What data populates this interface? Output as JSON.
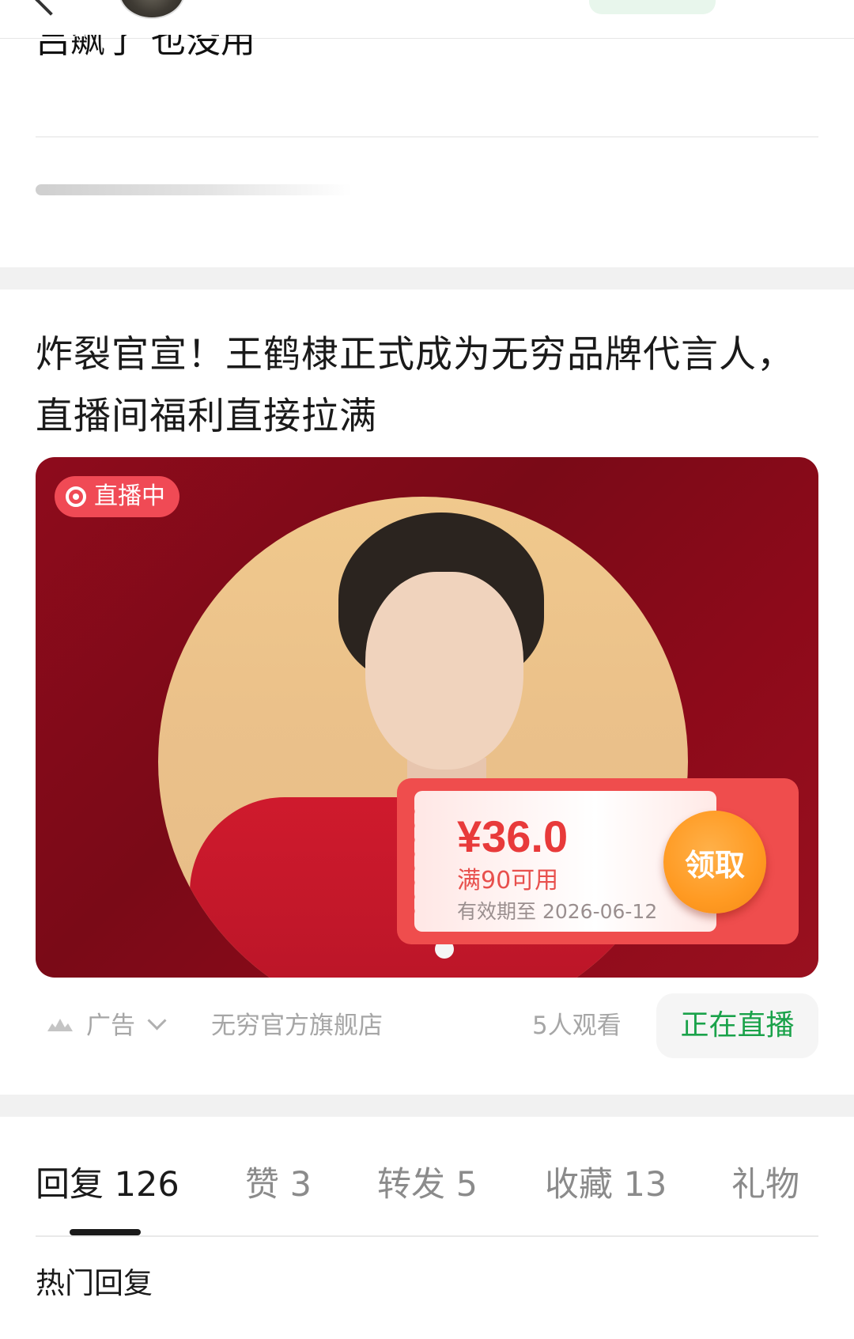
{
  "prev_post": {
    "snippet": "吕飙了 也没用"
  },
  "post": {
    "title": "炸裂官宣！王鹤棣正式成为无穷品牌代言人，直播间福利直接拉满"
  },
  "ad": {
    "live_badge": "直播中",
    "coupon": {
      "amount": "¥36.0",
      "condition": "满90可用",
      "expiry": "有效期至 2026-06-12",
      "claim_label": "领取"
    },
    "label": "广告",
    "shop_name": "无穷官方旗舰店",
    "viewers": "5人观看",
    "live_button": "正在直播"
  },
  "tabs": [
    {
      "label": "回复",
      "count": "126"
    },
    {
      "label": "赞",
      "count": "3"
    },
    {
      "label": "转发",
      "count": "5"
    },
    {
      "label": "收藏",
      "count": "13"
    },
    {
      "label": "礼物",
      "count": ""
    }
  ],
  "hot_replies_heading": "热门回复",
  "colors": {
    "live_green": "#1aa24a",
    "badge_red": "#f04a55",
    "banner_red": "#8e0b1c",
    "coupon_red": "#ef4d4d",
    "claim_orange": "#ff9a22"
  },
  "icons": [
    "back-arrow-icon",
    "live-dot-icon",
    "ad-logo-icon",
    "chevron-down-icon"
  ]
}
